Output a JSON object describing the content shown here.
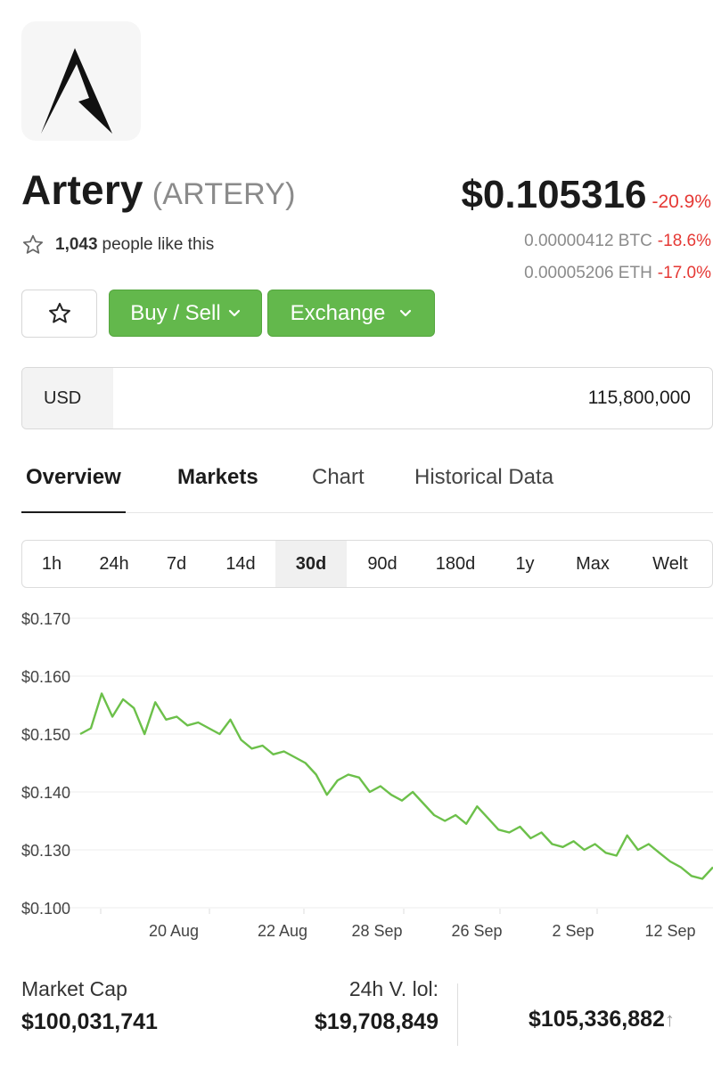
{
  "coin": {
    "name": "Artery",
    "symbol": "(ARTERY)",
    "likes_count": "1,043",
    "likes_suffix": "people like this"
  },
  "price": {
    "usd": "$0.105316",
    "usd_change": "-20.9%",
    "btc": "0.00000412 BTC",
    "btc_change": "-18.6%",
    "eth": "0.00005206 ETH",
    "eth_change": "-17.0%"
  },
  "actions": {
    "buy_sell": "Buy / Sell",
    "exchange": "Exchange"
  },
  "converter": {
    "currency": "USD",
    "amount": "115,800,000"
  },
  "tabs": [
    "Overview",
    "Markets",
    "Chart",
    "Historical Data"
  ],
  "ranges": [
    "1h",
    "24h",
    "7d",
    "14d",
    "30d",
    "90d",
    "180d",
    "1y",
    "Max",
    "Welt"
  ],
  "active_range": "30d",
  "stats": {
    "market_cap_label": "Market Cap",
    "market_cap_value": "$100,031,741",
    "volume_label": "24h V. lol:",
    "volume_value": "$19,708,849",
    "third_value": "$105,336,882",
    "third_suffix": "↑"
  },
  "colors": {
    "accent_green": "#63b84c",
    "line_green": "#6cc04a",
    "negative_red": "#e53935"
  },
  "chart_data": {
    "type": "line",
    "y_tick_labels": [
      "$0.170",
      "$0.160",
      "$0.150",
      "$0.140",
      "$0.130",
      "$0.100"
    ],
    "x_tick_labels": [
      "20 Aug",
      "22 Aug",
      "28 Sep",
      "26 Sep",
      "2 Sep",
      "12 Sep"
    ],
    "grid": true,
    "series": [
      {
        "values": [
          0.15,
          0.151,
          0.157,
          0.153,
          0.156,
          0.1545,
          0.15,
          0.1555,
          0.1525,
          0.153,
          0.1515,
          0.152,
          0.151,
          0.15,
          0.1525,
          0.149,
          0.1475,
          0.148,
          0.1465,
          0.147,
          0.146,
          0.145,
          0.143,
          0.1395,
          0.142,
          0.143,
          0.1425,
          0.14,
          0.141,
          0.1395,
          0.1385,
          0.14,
          0.138,
          0.136,
          0.135,
          0.136,
          0.1345,
          0.1375,
          0.1355,
          0.1335,
          0.133,
          0.134,
          0.132,
          0.133,
          0.131,
          0.1305,
          0.1315,
          0.13,
          0.131,
          0.1295,
          0.129,
          0.1325,
          0.13,
          0.131,
          0.1295,
          0.128,
          0.127,
          0.1255,
          0.125,
          0.127
        ]
      }
    ]
  }
}
